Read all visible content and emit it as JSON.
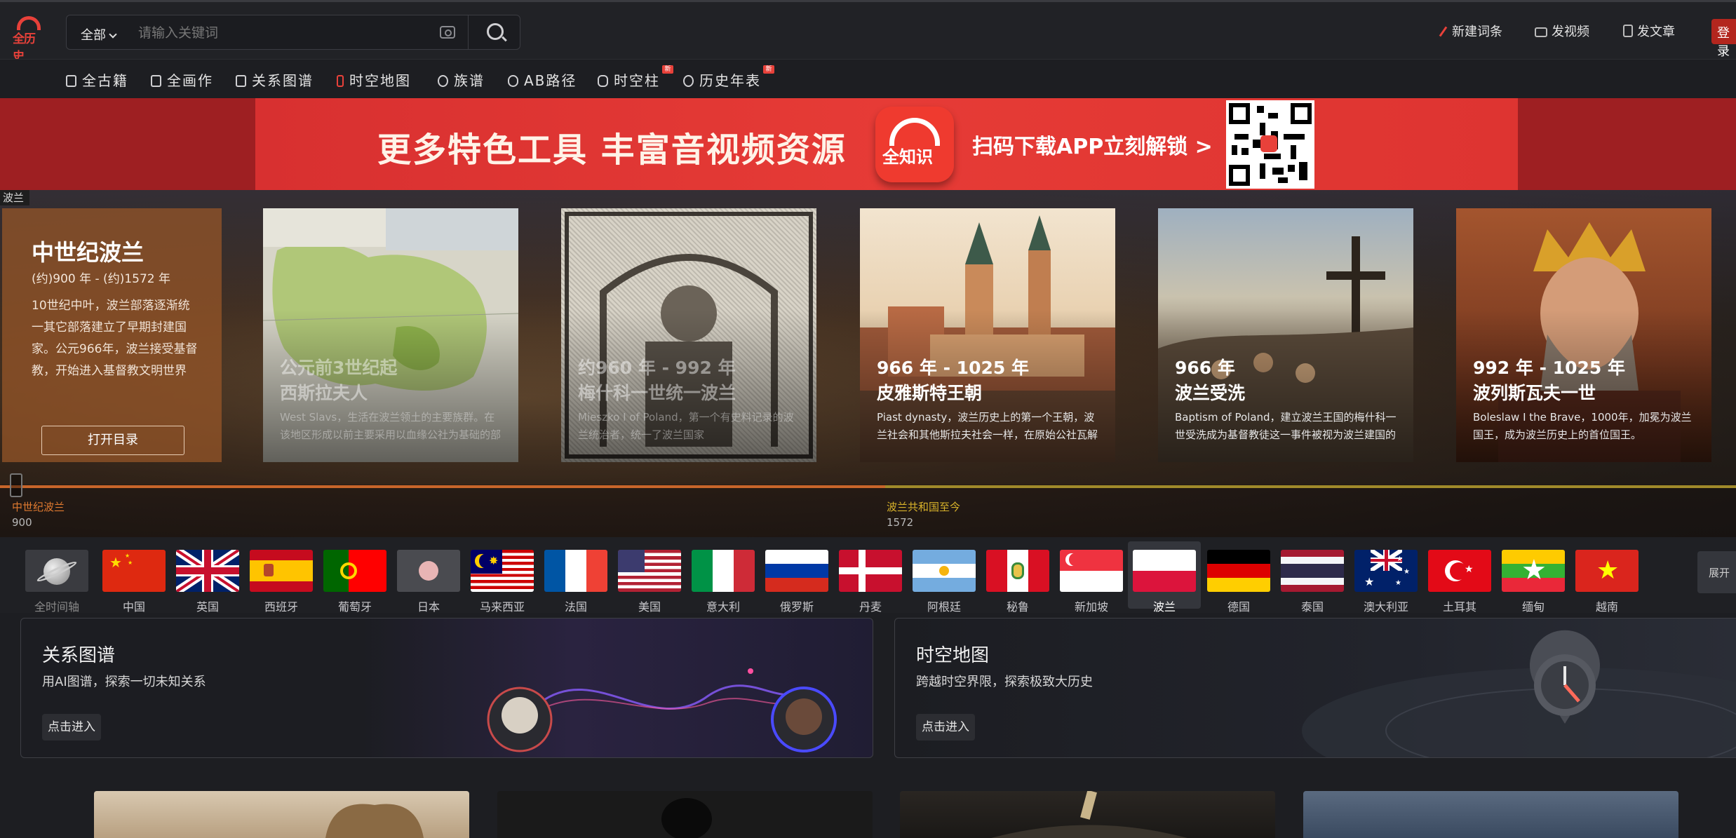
{
  "header": {
    "logo_text": "全历史",
    "search_scope": "全部",
    "search_placeholder": "请输入关键词",
    "actions": {
      "new_entry": "新建词条",
      "post_video": "发视频",
      "post_article": "发文章",
      "login": "登录"
    }
  },
  "nav": {
    "items": [
      {
        "label": "全古籍",
        "icon": "book-icon",
        "badge": ""
      },
      {
        "label": "全画作",
        "icon": "painting-icon",
        "badge": ""
      },
      {
        "label": "关系图谱",
        "icon": "graph-icon",
        "badge": ""
      },
      {
        "label": "时空地图",
        "icon": "map-icon",
        "badge": ""
      },
      {
        "label": "族谱",
        "icon": "family-icon",
        "badge": ""
      },
      {
        "label": "AB路径",
        "icon": "path-icon",
        "badge": ""
      },
      {
        "label": "时空柱",
        "icon": "database-icon",
        "badge": "新"
      },
      {
        "label": "历史年表",
        "icon": "clock-icon",
        "badge": "新"
      }
    ]
  },
  "banner": {
    "headline": "更多特色工具 丰富音视频资源",
    "app_name": "全知识",
    "cta": "扫码下载APP立刻解锁 >",
    "qr_label": "qr-code"
  },
  "hero": {
    "tag": "波兰",
    "intro": {
      "title": "中世纪波兰",
      "years": "(约)900 年 - (约)1572 年",
      "desc": "10世纪中叶，波兰部落逐渐统一其它部落建立了早期封建国家。公元966年，波兰接受基督教，开始进入基督教文明世界",
      "button": "打开目录"
    },
    "cards": [
      {
        "years": "公元前3世纪起",
        "title": "西斯拉夫人",
        "desc": "West Slavs，生活在波兰领土的主要族群。在该地区形成以前主要采用以血缘公社为基础的部"
      },
      {
        "years": "约960 年 - 992 年",
        "title": "梅什科一世统一波兰",
        "desc": "Mieszko I of Poland，第一个有史料记录的波兰统治者，统一了波兰国家"
      },
      {
        "years": "966 年 - 1025 年",
        "title": "皮雅斯特王朝",
        "desc": "Piast dynasty，波兰历史上的第一个王朝，波兰社会和其他斯拉夫社会一样，在原始公社瓦解后"
      },
      {
        "years": "966 年",
        "title": "波兰受洗",
        "desc": "Baptism of Poland，建立波兰王国的梅什科一世受洗成为基督教徒这一事件被视为波兰建国的开"
      },
      {
        "years": "992 年 - 1025 年",
        "title": "波列斯瓦夫一世",
        "desc": "Boleslaw I the Brave，1000年，加冕为波兰国王，成为波兰历史上的首位国王。"
      }
    ],
    "timeline": {
      "periods": [
        {
          "name": "中世纪波兰",
          "start": "900",
          "color": "#e0782e"
        },
        {
          "name": "波兰共和国至今",
          "start": "1572",
          "color": "#c9a227"
        }
      ]
    }
  },
  "countries": {
    "items": [
      {
        "name": "全时间轴",
        "id": "all"
      },
      {
        "name": "中国",
        "id": "cn"
      },
      {
        "name": "英国",
        "id": "gb"
      },
      {
        "name": "西班牙",
        "id": "es"
      },
      {
        "name": "葡萄牙",
        "id": "pt"
      },
      {
        "name": "日本",
        "id": "jp"
      },
      {
        "name": "马来西亚",
        "id": "my"
      },
      {
        "name": "法国",
        "id": "fr"
      },
      {
        "name": "美国",
        "id": "us"
      },
      {
        "name": "意大利",
        "id": "it"
      },
      {
        "name": "俄罗斯",
        "id": "ru"
      },
      {
        "name": "丹麦",
        "id": "dk"
      },
      {
        "name": "阿根廷",
        "id": "ar"
      },
      {
        "name": "秘鲁",
        "id": "pe"
      },
      {
        "name": "新加坡",
        "id": "sg"
      },
      {
        "name": "波兰",
        "id": "pl"
      },
      {
        "name": "德国",
        "id": "de"
      },
      {
        "name": "泰国",
        "id": "th"
      },
      {
        "name": "澳大利亚",
        "id": "au"
      },
      {
        "name": "土耳其",
        "id": "tr"
      },
      {
        "name": "缅甸",
        "id": "mm"
      },
      {
        "name": "越南",
        "id": "vn"
      }
    ],
    "selected": "波兰",
    "expand_label": "展开"
  },
  "features": [
    {
      "title": "关系图谱",
      "subtitle": "用AI图谱，探索一切未知关系",
      "button": "点击进入"
    },
    {
      "title": "时空地图",
      "subtitle": "跨越时空界限，探索极致大历史",
      "button": "点击进入"
    }
  ],
  "colors": {
    "brand": "#e8413a",
    "bg": "#1d1e22"
  }
}
